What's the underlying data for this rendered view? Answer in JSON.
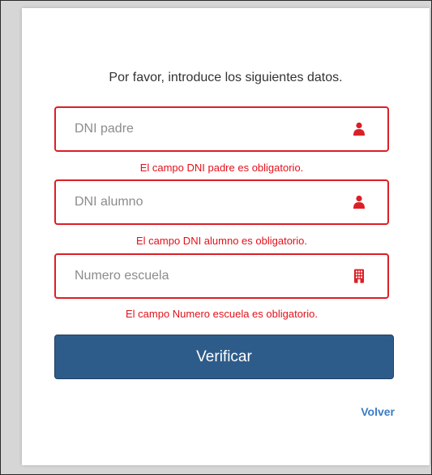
{
  "form": {
    "intro": "Por favor, introduce los siguientes datos.",
    "fields": [
      {
        "placeholder": "DNI padre",
        "value": "",
        "icon": "user-icon",
        "error": "El campo DNI padre es obligatorio."
      },
      {
        "placeholder": "DNI alumno",
        "value": "",
        "icon": "user-icon",
        "error": "El campo DNI alumno es obligatorio."
      },
      {
        "placeholder": "Numero escuela",
        "value": "",
        "icon": "building-icon",
        "error": "El campo Numero escuela es obligatorio."
      }
    ],
    "submit_label": "Verificar",
    "back_label": "Volver"
  },
  "colors": {
    "error": "#e3101a",
    "field_border": "#dc1f26",
    "button": "#2e5c8a",
    "link": "#3a7cc4"
  }
}
